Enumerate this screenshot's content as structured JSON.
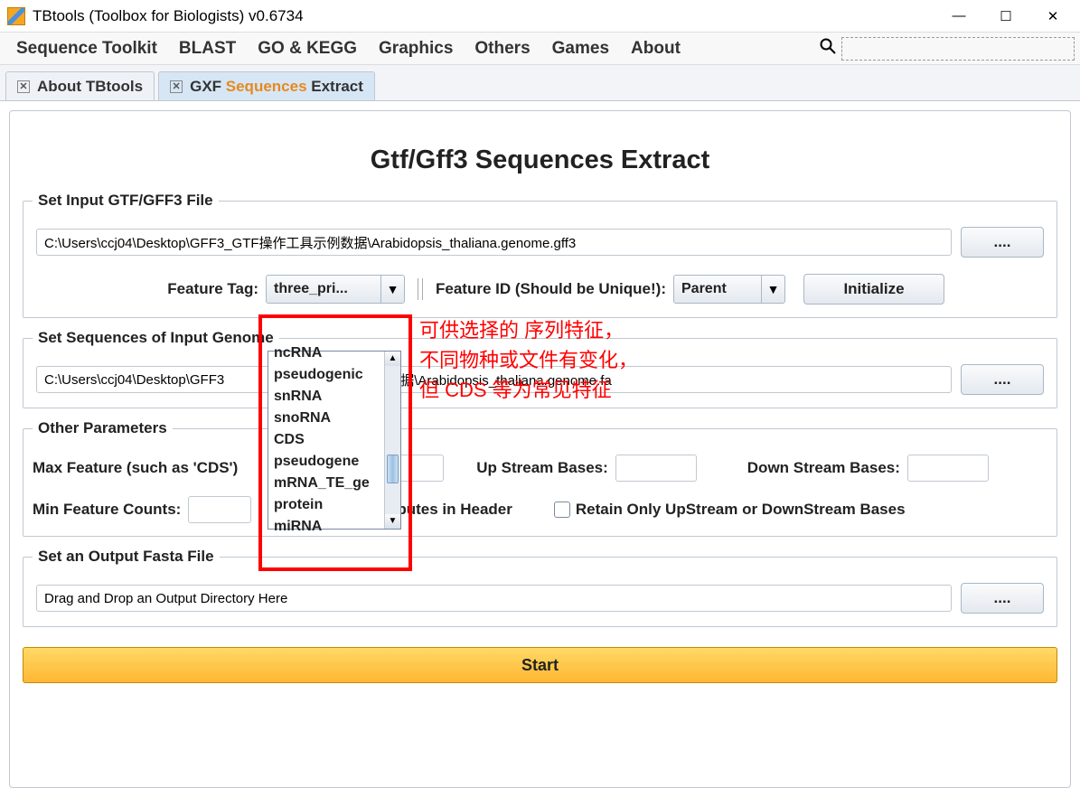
{
  "window": {
    "title": "TBtools (Toolbox for Biologists) v0.6734"
  },
  "menubar": {
    "items": [
      "Sequence Toolkit",
      "BLAST",
      "GO & KEGG",
      "Graphics",
      "Others",
      "Games",
      "About"
    ]
  },
  "tabs": [
    {
      "label": "About TBtools",
      "active": false
    },
    {
      "label_pre": "GXF ",
      "label_hi": "Sequences",
      "label_post": " Extract",
      "active": true
    }
  ],
  "page": {
    "title": "Gtf/Gff3 Sequences Extract"
  },
  "section_gff": {
    "legend": "Set Input GTF/GFF3 File",
    "path": "C:\\Users\\ccj04\\Desktop\\GFF3_GTF操作工具示例数据\\Arabidopsis_thaliana.genome.gff3",
    "browse": "....",
    "feature_tag_label": "Feature Tag:",
    "feature_tag_selected": "three_pri...",
    "feature_id_label": "Feature ID (Should be Unique!):",
    "feature_id_selected": "Parent",
    "initialize": "Initialize"
  },
  "section_genome": {
    "legend": "Set Sequences of Input Genome",
    "path_left": "C:\\Users\\ccj04\\Desktop\\GFF3",
    "path_right": "数据\\Arabidopsis_thaliana.genome.fa",
    "browse": "...."
  },
  "section_other": {
    "legend": "Other Parameters",
    "max_feature_label": "Max Feature (such as 'CDS')",
    "up_stream_label": "Up Stream Bases:",
    "down_stream_label": "Down Stream Bases:",
    "min_feature_label": "Min Feature Counts:",
    "retain_attr_label": "Retain Attributes in Header",
    "retain_only_label": "Retain Only UpStream or DownStream Bases"
  },
  "section_output": {
    "legend": "Set an Output Fasta File",
    "placeholder_text": "Drag and Drop an Output Directory Here",
    "browse": "...."
  },
  "start_label": "Start",
  "dropdown": {
    "items": [
      "ncRNA",
      "pseudogenic",
      "snRNA",
      "snoRNA",
      "CDS",
      "pseudogene",
      "mRNA_TE_ge",
      "protein",
      "miRNA"
    ]
  },
  "annotation": {
    "lines": [
      "可供选择的 序列特征，",
      "不同物种或文件有变化，",
      "但 CDS 等为常见特征"
    ]
  }
}
